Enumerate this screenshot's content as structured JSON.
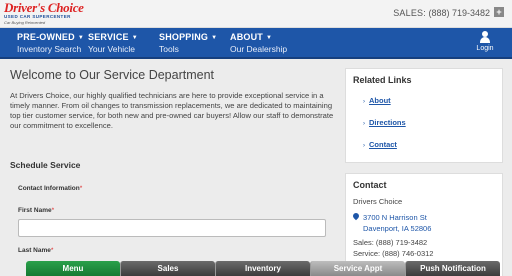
{
  "header": {
    "logo": {
      "main": "Driver's Choice",
      "sub": "USED CAR SUPERCENTER",
      "tagline": "Car Buying Reinvented"
    },
    "sales_label": "SALES:",
    "sales_phone": "(888) 719-3482",
    "expand_icon": "plus-icon"
  },
  "nav": {
    "items": [
      {
        "title": "PRE-OWNED",
        "subtitle": "Inventory Search"
      },
      {
        "title": "SERVICE",
        "subtitle": "Your Vehicle"
      },
      {
        "title": "SHOPPING",
        "subtitle": "Tools"
      },
      {
        "title": "ABOUT",
        "subtitle": "Our Dealership"
      }
    ],
    "login_label": "Login",
    "login_icon": "user-icon"
  },
  "main": {
    "title": "Welcome to Our Service Department",
    "intro": "At Drivers Choice, our highly qualified technicians are here to provide exceptional service in a timely manner. From oil changes to transmission replacements, we are dedicated to maintaining top tier customer service, for both new and pre-owned car buyers! Allow our staff to demonstrate our commitment to excellence.",
    "schedule_title": "Schedule Service",
    "contact_info_label": "Contact Information",
    "first_name_label": "First Name",
    "first_name_value": "",
    "last_name_label": "Last Name",
    "required_mark": "*"
  },
  "sidebar": {
    "related_title": "Related Links",
    "links": [
      "About",
      "Directions",
      "Contact"
    ],
    "contact_title": "Contact",
    "business_name": "Drivers Choice",
    "address_line1": "3700 N Harrison St",
    "address_line2": "Davenport, IA 52806",
    "sales_phone": "Sales: (888) 719-3482",
    "service_phone": "Service: (888) 746-0312"
  },
  "bottom_bar": {
    "tabs": [
      "Menu",
      "Sales",
      "Inventory",
      "Service Appt",
      "Push Notification"
    ],
    "active": "Menu"
  },
  "colors": {
    "nav_blue": "#1e56a8",
    "logo_red": "#d22222",
    "active_green": "#1f8d3e"
  }
}
